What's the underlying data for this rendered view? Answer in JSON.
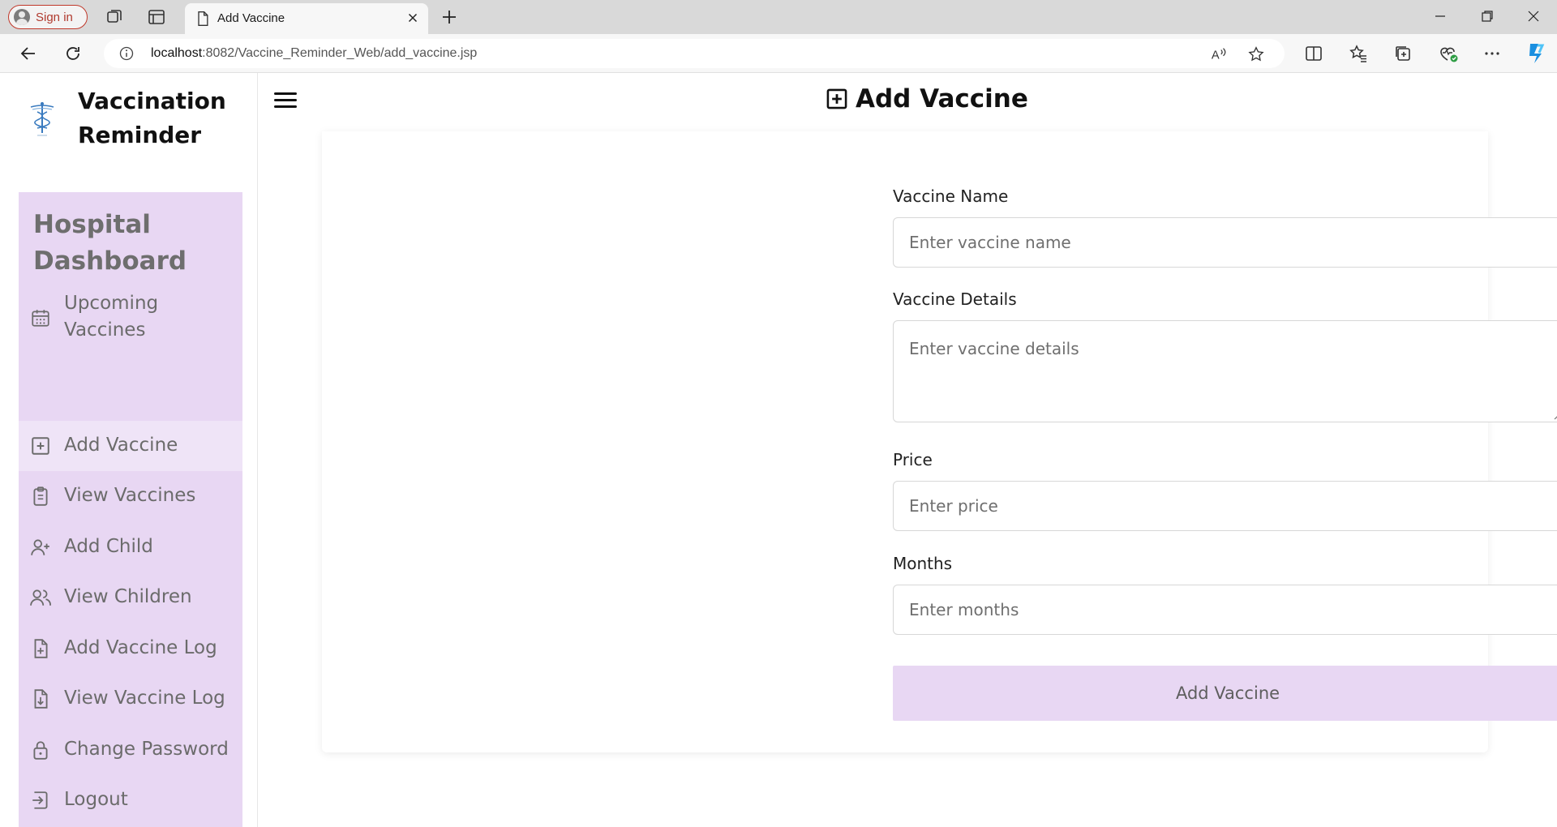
{
  "browser": {
    "signin_label": "Sign in",
    "tab_title": "Add Vaccine",
    "url_host": "localhost",
    "url_rest": ":8082/Vaccine_Reminder_Web/add_vaccine.jsp"
  },
  "app": {
    "brand_name": "Vaccination Reminder",
    "page_title": "Add Vaccine",
    "menu_title": "Hospital Dashboard",
    "menu_items": [
      {
        "label": "Upcoming Vaccines",
        "icon": "calendar-icon"
      },
      {
        "label": "Add Vaccine",
        "icon": "plus-square-icon",
        "active": true
      },
      {
        "label": "View Vaccines",
        "icon": "clipboard-icon"
      },
      {
        "label": "Add Child",
        "icon": "user-plus-icon"
      },
      {
        "label": "View Children",
        "icon": "users-icon"
      },
      {
        "label": "Add Vaccine Log",
        "icon": "file-plus-icon"
      },
      {
        "label": "View Vaccine Log",
        "icon": "file-download-icon"
      },
      {
        "label": "Change Password",
        "icon": "lock-icon"
      },
      {
        "label": "Logout",
        "icon": "logout-icon"
      }
    ]
  },
  "form": {
    "name_label": "Vaccine Name",
    "name_placeholder": "Enter vaccine name",
    "details_label": "Vaccine Details",
    "details_placeholder": "Enter vaccine details",
    "price_label": "Price",
    "price_placeholder": "Enter price",
    "months_label": "Months",
    "months_placeholder": "Enter months",
    "submit_label": "Add Vaccine"
  },
  "colors": {
    "accent": "#e8d7f3",
    "sign_in_border": "#c0392b"
  }
}
